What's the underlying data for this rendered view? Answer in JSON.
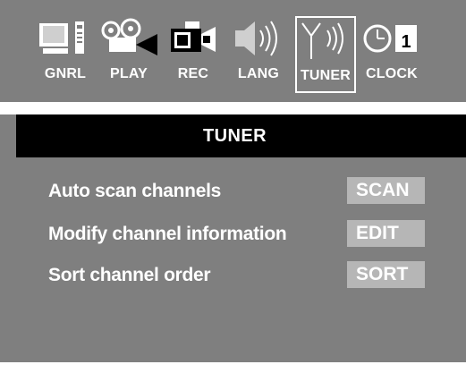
{
  "tabs": [
    {
      "label": "GNRL",
      "icon": "tv-remote-icon"
    },
    {
      "label": "PLAY",
      "icon": "film-reel-play-icon"
    },
    {
      "label": "REC",
      "icon": "camcorder-icon"
    },
    {
      "label": "LANG",
      "icon": "speaker-icon"
    },
    {
      "label": "TUNER",
      "icon": "antenna-icon",
      "active": true
    },
    {
      "label": "CLOCK",
      "icon": "clock-calendar-icon"
    }
  ],
  "title": "TUNER",
  "menu": [
    {
      "text": "Auto scan channels",
      "button": "SCAN"
    },
    {
      "text": "Modify channel information",
      "button": "EDIT"
    },
    {
      "text": "Sort channel order",
      "button": "SORT"
    }
  ],
  "clock_day": "1",
  "colors": {
    "background": "#7f7f7f",
    "title_bar": "#000000",
    "button": "#b6b6b6",
    "text": "#ffffff"
  }
}
